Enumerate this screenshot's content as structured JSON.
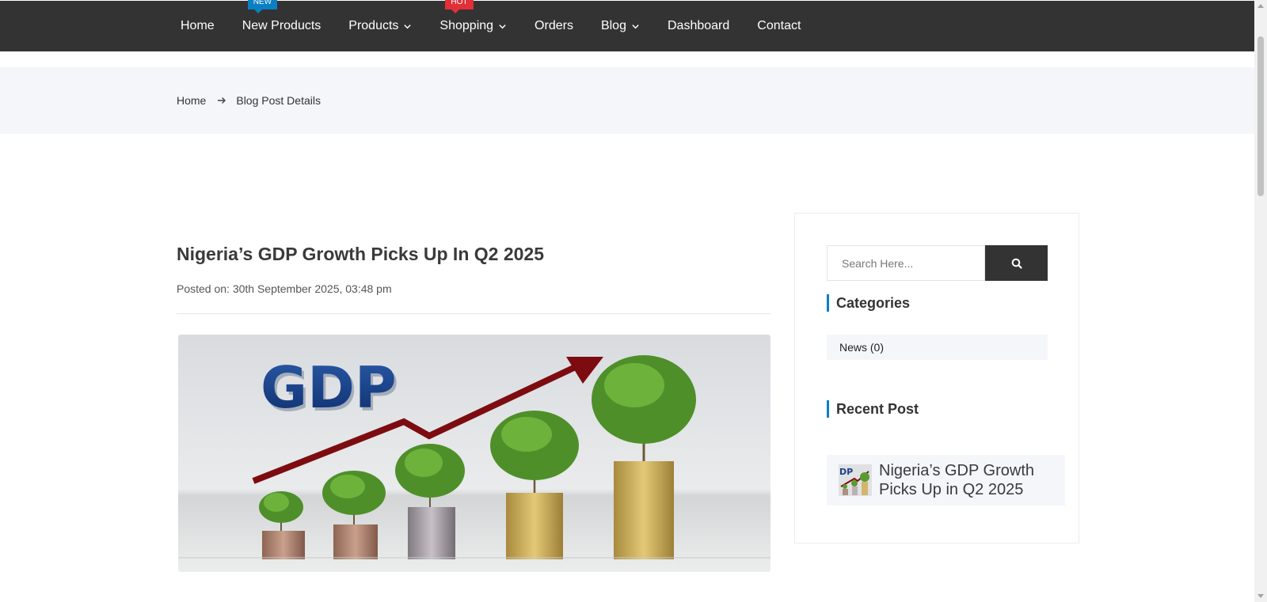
{
  "nav": {
    "items": [
      {
        "label": "Home"
      },
      {
        "label": "New Products",
        "badge": "NEW"
      },
      {
        "label": "Products"
      },
      {
        "label": "Shopping",
        "badge": "HOT"
      },
      {
        "label": "Orders"
      },
      {
        "label": "Blog"
      },
      {
        "label": "Dashboard"
      },
      {
        "label": "Contact"
      }
    ]
  },
  "breadcrumb": {
    "home": "Home",
    "current": "Blog Post Details"
  },
  "post": {
    "title": "Nigeria’s GDP Growth Picks Up In Q2 2025",
    "meta": "Posted on: 30th September 2025, 03:48 pm",
    "image_text": "GDP"
  },
  "sidebar": {
    "search_placeholder": "Search Here...",
    "categories_title": "Categories",
    "categories": [
      {
        "label": "News (0)"
      }
    ],
    "recent_title": "Recent Post",
    "recent_posts": [
      {
        "title": "Nigeria’s GDP Growth Picks Up in Q2 2025"
      }
    ]
  },
  "colors": {
    "nav_bg": "#333333",
    "accent": "#0a7fc2",
    "badge_new": "#0a7fc2",
    "badge_hot": "#e0303a",
    "band_bg": "#f5f6fa"
  }
}
